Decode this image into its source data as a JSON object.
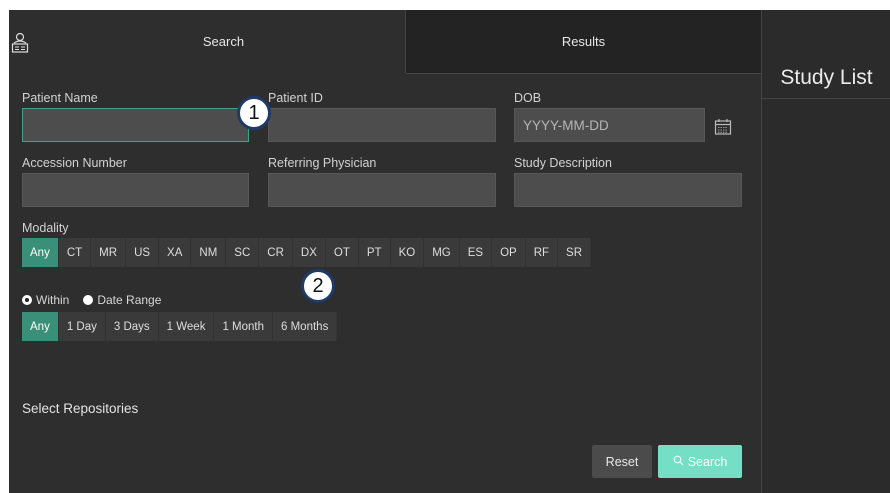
{
  "tabs": {
    "search_label": "Search",
    "results_label": "Results"
  },
  "side_panel": {
    "title": "Study List"
  },
  "fields": {
    "patient_name": {
      "label": "Patient Name",
      "value": "",
      "placeholder": ""
    },
    "patient_id": {
      "label": "Patient ID",
      "value": "",
      "placeholder": ""
    },
    "dob": {
      "label": "DOB",
      "value": "",
      "placeholder": "YYYY-MM-DD"
    },
    "accession_number": {
      "label": "Accession Number",
      "value": "",
      "placeholder": ""
    },
    "referring_physician": {
      "label": "Referring Physician",
      "value": "",
      "placeholder": ""
    },
    "study_description": {
      "label": "Study Description",
      "value": "",
      "placeholder": ""
    }
  },
  "modality": {
    "label": "Modality",
    "options": [
      "Any",
      "CT",
      "MR",
      "US",
      "XA",
      "NM",
      "SC",
      "CR",
      "DX",
      "OT",
      "PT",
      "KO",
      "MG",
      "ES",
      "OP",
      "RF",
      "SR"
    ],
    "selected": "Any"
  },
  "date_mode": {
    "within_label": "Within",
    "range_label": "Date Range",
    "selected": "Within"
  },
  "within": {
    "options": [
      "Any",
      "1 Day",
      "3 Days",
      "1 Week",
      "1 Month",
      "6 Months"
    ],
    "selected": "Any"
  },
  "repositories": {
    "title": "Select Repositories"
  },
  "actions": {
    "reset_label": "Reset",
    "search_label": "Search"
  },
  "callouts": {
    "one": "1",
    "two": "2"
  },
  "icons": {
    "tab_icon": "user-id-card-icon",
    "calendar": "calendar-icon",
    "search": "search-icon"
  },
  "colors": {
    "accent": "#3a8f78",
    "search_button": "#74dfc4",
    "background": "#2e2e2e"
  }
}
